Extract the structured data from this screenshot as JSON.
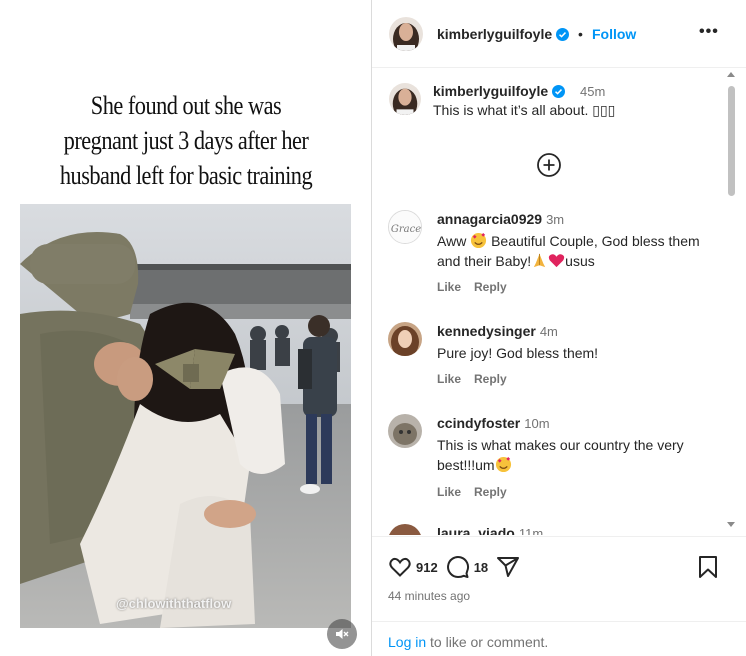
{
  "media": {
    "caption_lines": [
      "She found out she was",
      "pregnant just 3 days after her",
      "husband left for basic training"
    ],
    "watermark": "@chlowiththatflow",
    "mute_icon": "speaker-muted-icon"
  },
  "header": {
    "username": "kimberlyguilfoyle",
    "separator": "•",
    "follow_label": "Follow",
    "more_label": "•••"
  },
  "post": {
    "username": "kimberlyguilfoyle",
    "time": "45m",
    "caption": "This is what it’s all about. ▯▯▯"
  },
  "comments": [
    {
      "username": "annagarcia0929",
      "time": "3m",
      "text_a": "Aww ",
      "text_b": " Beautiful Couple, God bless them and their Baby!",
      "text_c": "usus",
      "like": "Like",
      "reply": "Reply"
    },
    {
      "username": "kennedysinger",
      "time": "4m",
      "text": "Pure joy! God bless them!",
      "like": "Like",
      "reply": "Reply"
    },
    {
      "username": "ccindyfoster",
      "time": "10m",
      "text": "This is what makes our country the very best!!!um",
      "like": "Like",
      "reply": "Reply"
    },
    {
      "username": "laura_viado",
      "time": "11m"
    }
  ],
  "footer": {
    "likes": "912",
    "comments": "18",
    "time_ago": "44 minutes ago",
    "login_link": "Log in",
    "login_rest": " to like or comment."
  },
  "colors": {
    "link_blue": "#0095f6",
    "verified_blue": "#0095f6",
    "secondary_text": "#737373",
    "heart_red": "#e0245e"
  }
}
